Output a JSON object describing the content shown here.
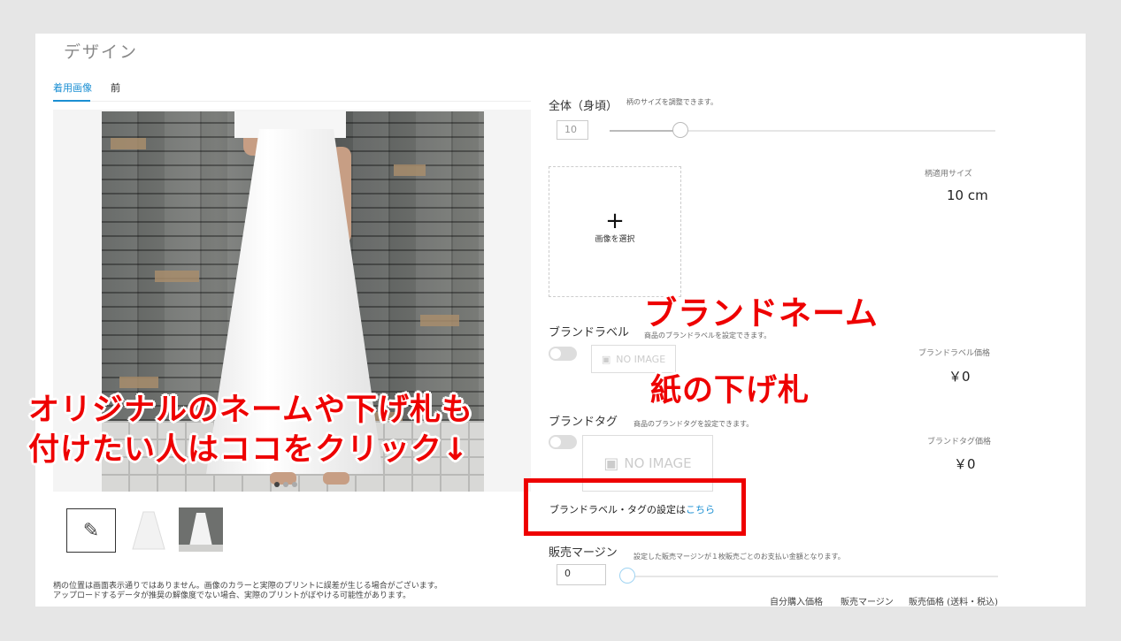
{
  "page": {
    "title": "デザイン",
    "tabs": [
      {
        "label": "着用画像",
        "active": true
      },
      {
        "label": "前",
        "active": false
      }
    ]
  },
  "gallery": {
    "thumbnails": [
      "pattern-icon",
      "skirt-flat",
      "skirt-model"
    ],
    "notes": [
      "柄の位置は画面表示通りではありません。画像のカラーと実際のプリントに誤差が生じる場合がございます。",
      "アップロードするデータが推奨の解像度でない場合、実際のプリントがぼやける可能性があります。"
    ]
  },
  "size_section": {
    "label": "全体（身頃）",
    "hint": "柄のサイズを調整できます。",
    "value": "10",
    "slider_fraction": 0.18,
    "applied_label": "柄適用サイズ",
    "applied_value": "10 cm"
  },
  "upload": {
    "plus": "+",
    "label": "画像を選択"
  },
  "brand_label": {
    "label": "ブランドラベル",
    "hint": "商品のブランドラベルを設定できます。",
    "placeholder": "NO IMAGE",
    "price_label": "ブランドラベル価格",
    "price": "￥0"
  },
  "brand_tag": {
    "label": "ブランドタグ",
    "hint": "商品のブランドタグを設定できます。",
    "placeholder": "NO IMAGE",
    "price_label": "ブランドタグ価格",
    "price": "￥0"
  },
  "brand_settings_link": {
    "prefix": "ブランドラベル・タグの設定は",
    "link": "こちら"
  },
  "margin": {
    "label": "販売マージン",
    "hint": "設定した販売マージンが１枚販売ごとのお支払い金額となります。",
    "value": "0",
    "slider_fraction": 0
  },
  "footer_columns": [
    "自分購入価格",
    "販売マージン",
    "販売価格 (送料・税込)"
  ],
  "annotations": {
    "brand_name": "ブランドネーム",
    "paper_tag": "紙の下げ札",
    "callout_line1": "オリジナルのネームや下げ札も",
    "callout_line2": "付けたい人はココをクリック↓"
  },
  "colors": {
    "accent": "#1b8fd3",
    "annotation_red": "#e00000"
  }
}
